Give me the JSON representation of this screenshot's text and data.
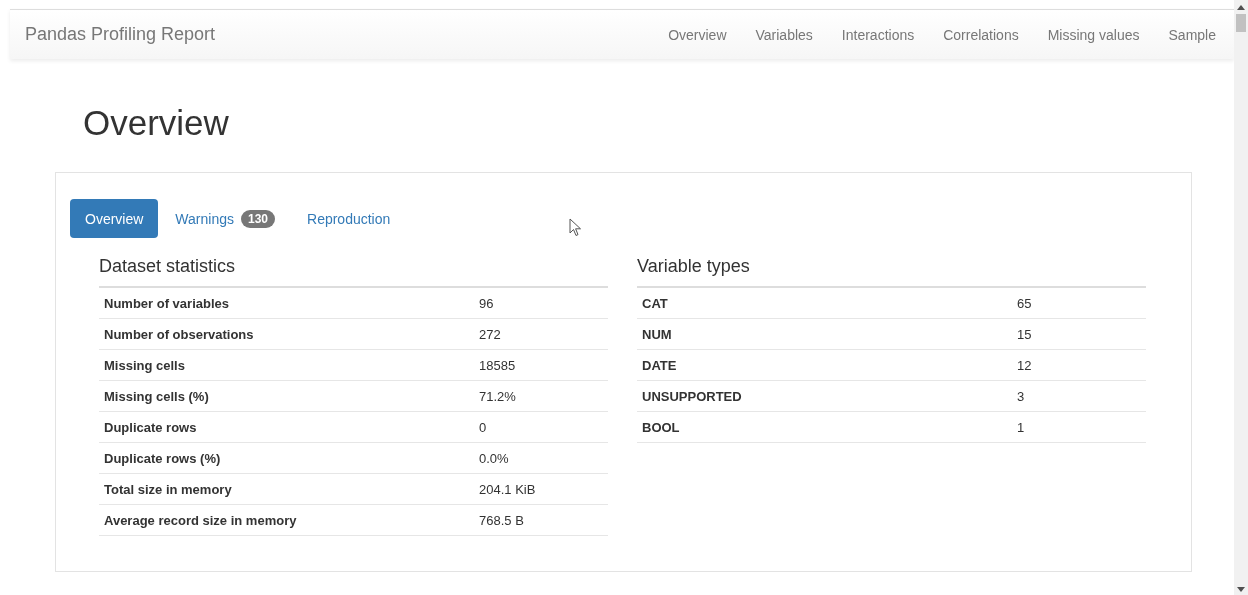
{
  "navbar": {
    "brand": "Pandas Profiling Report",
    "links": [
      "Overview",
      "Variables",
      "Interactions",
      "Correlations",
      "Missing values",
      "Sample"
    ]
  },
  "page_title": "Overview",
  "tabs": [
    {
      "label": "Overview",
      "selected": true
    },
    {
      "label": "Warnings",
      "badge": "130",
      "selected": false
    },
    {
      "label": "Reproduction",
      "selected": false
    }
  ],
  "dataset_statistics": {
    "title": "Dataset statistics",
    "rows": [
      {
        "label": "Number of variables",
        "value": "96"
      },
      {
        "label": "Number of observations",
        "value": "272"
      },
      {
        "label": "Missing cells",
        "value": "18585"
      },
      {
        "label": "Missing cells (%)",
        "value": "71.2%"
      },
      {
        "label": "Duplicate rows",
        "value": "0"
      },
      {
        "label": "Duplicate rows (%)",
        "value": "0.0%"
      },
      {
        "label": "Total size in memory",
        "value": "204.1 KiB"
      },
      {
        "label": "Average record size in memory",
        "value": "768.5 B"
      }
    ]
  },
  "variable_types": {
    "title": "Variable types",
    "rows": [
      {
        "label": "CAT",
        "value": "65"
      },
      {
        "label": "NUM",
        "value": "15"
      },
      {
        "label": "DATE",
        "value": "12"
      },
      {
        "label": "UNSUPPORTED",
        "value": "3"
      },
      {
        "label": "BOOL",
        "value": "1"
      }
    ]
  }
}
